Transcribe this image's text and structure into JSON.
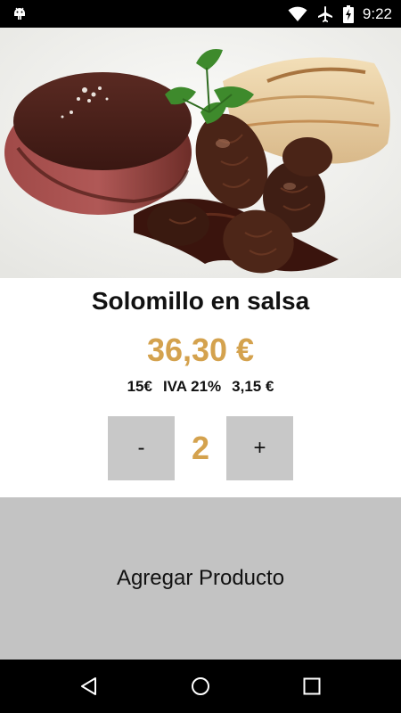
{
  "status_bar": {
    "time": "9:22",
    "icons": [
      "android-icon",
      "wifi-icon",
      "airplane-icon",
      "battery-charging-icon"
    ]
  },
  "product": {
    "image": "steak-with-mushroom-sauce-photo",
    "name": "Solomillo en salsa",
    "price": "36,30 €",
    "base_price": "15€",
    "tax_label": "IVA 21%",
    "tax_amount": "3,15 €"
  },
  "quantity": {
    "minus_label": "-",
    "value": "2",
    "plus_label": "+"
  },
  "actions": {
    "add_label": "Agregar Producto"
  },
  "nav_bar": {
    "icons": [
      "back-icon",
      "home-icon",
      "recents-icon"
    ]
  },
  "colors": {
    "accent": "#d4a24e",
    "button_bg": "#c8c8c8",
    "add_bg": "#c3c3c3"
  }
}
